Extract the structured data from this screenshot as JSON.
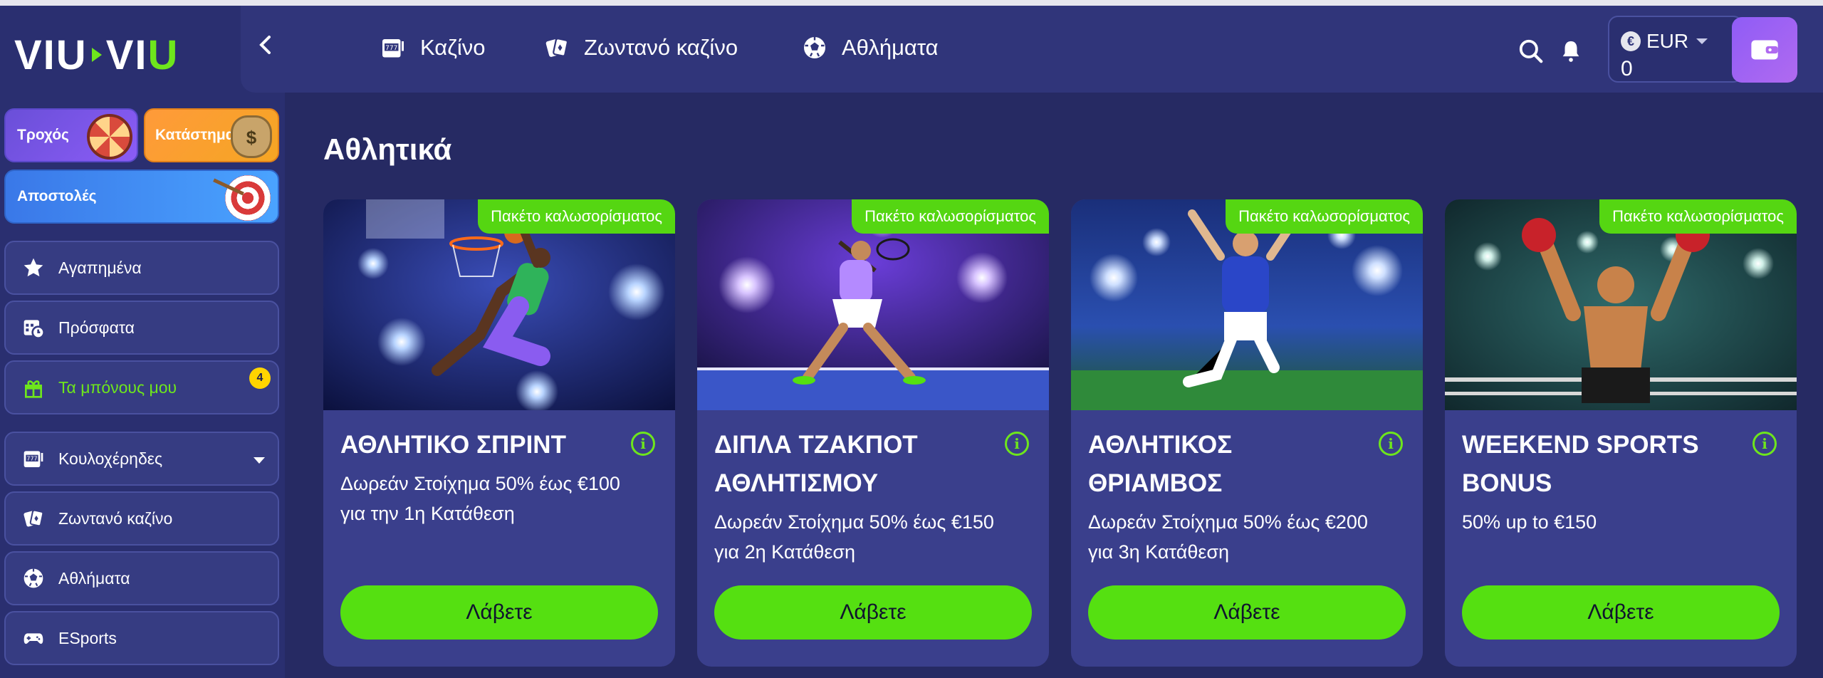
{
  "brand": {
    "logo_left": "VIU",
    "logo_right": "VI",
    "logo_u": "U"
  },
  "header": {
    "nav": [
      {
        "label": "Καζίνο",
        "icon": "slot-machine-icon"
      },
      {
        "label": "Ζωντανό καζίνο",
        "icon": "cards-icon"
      },
      {
        "label": "Αθλήματα",
        "icon": "football-icon"
      }
    ],
    "currency": "EUR",
    "currency_symbol": "€",
    "balance": "0"
  },
  "sidebar": {
    "promos": {
      "wheel": "Τροχός",
      "shop": "Κατάστημα",
      "missions": "Αποστολές"
    },
    "items": [
      {
        "label": "Αγαπημένα",
        "icon": "star-icon"
      },
      {
        "label": "Πρόσφατα",
        "icon": "calendar-clock-icon"
      },
      {
        "label": "Τα μπόνους μου",
        "icon": "gift-icon",
        "badge": "4"
      },
      {
        "label": "Κουλοχέρηδες",
        "icon": "slot-machine-icon"
      },
      {
        "label": "Ζωντανό καζίνο",
        "icon": "cards-icon"
      },
      {
        "label": "Αθλήματα",
        "icon": "football-icon"
      },
      {
        "label": "ESports",
        "icon": "gamepad-icon"
      }
    ]
  },
  "main": {
    "title": "Αθλητικά",
    "cards": [
      {
        "tag": "Πακέτο καλωσορίσματος",
        "title": "ΑΘΛΗΤΙΚΟ ΣΠΡΙΝΤ",
        "description": "Δωρεάν Στοίχημα 50% έως €100 για την 1η Κατάθεση",
        "button": "Λάβετε",
        "image": "basketball"
      },
      {
        "tag": "Πακέτο καλωσορίσματος",
        "title": "ΔΙΠΛΑ ΤΖΑΚΠΟΤ ΑΘΛΗΤΙΣΜΟΥ",
        "description": "Δωρεάν Στοίχημα 50% έως €150 για 2η Κατάθεση",
        "button": "Λάβετε",
        "image": "tennis"
      },
      {
        "tag": "Πακέτο καλωσορίσματος",
        "title": "ΑΘΛΗΤΙΚΟΣ ΘΡΙΑΜΒΟΣ",
        "description": "Δωρεάν Στοίχημα 50% έως €200 για 3η Κατάθεση",
        "button": "Λάβετε",
        "image": "football"
      },
      {
        "tag": "Πακέτο καλωσορίσματος",
        "title": "WEEKEND SPORTS BONUS",
        "description": "50% up to €150",
        "button": "Λάβετε",
        "image": "boxing"
      }
    ]
  },
  "colors": {
    "accent_green": "#55e011",
    "background": "#262a63",
    "card": "#3a3f8c",
    "wallet": "#9a5ff3"
  }
}
